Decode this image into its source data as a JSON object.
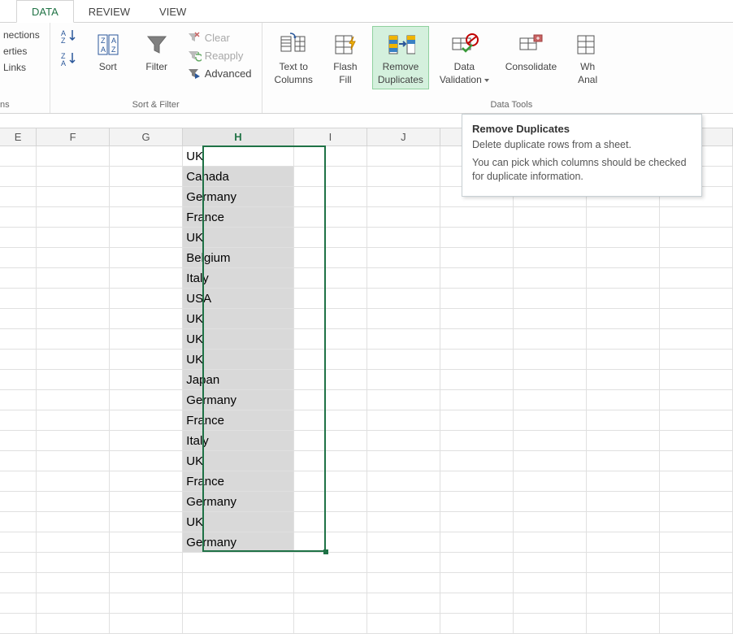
{
  "tabs": {
    "data": "DATA",
    "review": "REVIEW",
    "view": "VIEW"
  },
  "connections": {
    "nections": "nections",
    "erties": "erties",
    "links": "Links",
    "label": "ns"
  },
  "sort_filter": {
    "sort": "Sort",
    "filter": "Filter",
    "clear": "Clear",
    "reapply": "Reapply",
    "advanced": "Advanced",
    "label": "Sort & Filter"
  },
  "data_tools": {
    "text_to_columns1": "Text to",
    "text_to_columns2": "Columns",
    "flash_fill1": "Flash",
    "flash_fill2": "Fill",
    "remove_dup1": "Remove",
    "remove_dup2": "Duplicates",
    "data_val1": "Data",
    "data_val2": "Validation",
    "consolidate": "Consolidate",
    "whatif1": "Wh",
    "whatif2": "Anal",
    "label": "Data Tools"
  },
  "tooltip": {
    "title": "Remove Duplicates",
    "line1": "Delete duplicate rows from a sheet.",
    "line2": "You can pick which columns should be checked for duplicate information."
  },
  "columns": [
    "E",
    "F",
    "G",
    "H",
    "I",
    "J",
    "",
    "",
    "",
    ""
  ],
  "data_h": [
    "UK",
    "Canada",
    "Germany",
    "France",
    "UK",
    "Belgium",
    "Italy",
    "USA",
    "UK",
    "UK",
    "UK",
    "Japan",
    "Germany",
    "France",
    "Italy",
    "UK",
    "France",
    "Germany",
    "UK",
    "Germany"
  ],
  "col_widths": {
    "E": 50,
    "F": 100,
    "G": 100,
    "H": 152,
    "I": 100,
    "J": 100,
    "K": 100,
    "L": 100,
    "M": 100,
    "N": 100
  }
}
